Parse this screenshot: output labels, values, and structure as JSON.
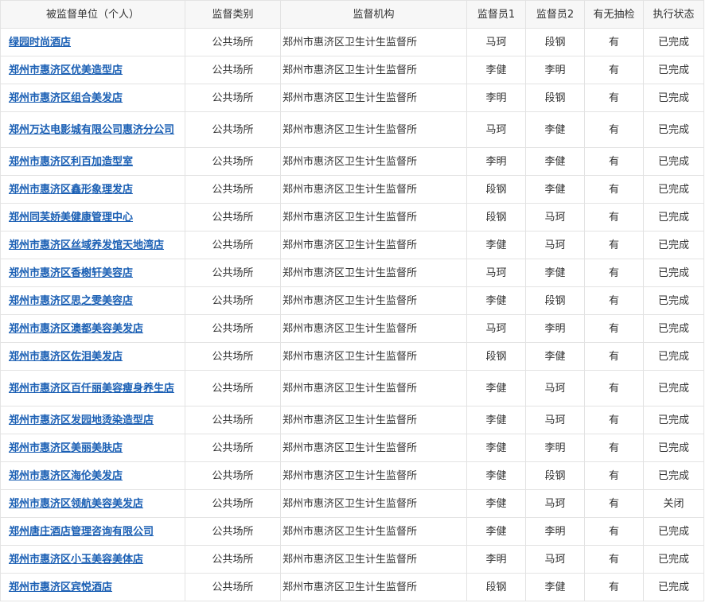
{
  "table": {
    "headers": [
      "被监督单位（个人）",
      "监督类别",
      "监督机构",
      "监督员1",
      "监督员2",
      "有无抽检",
      "执行状态"
    ],
    "rows": [
      {
        "unit": "绿园时尚酒店",
        "category": "公共场所",
        "agency": "郑州市惠济区卫生计生监督所",
        "inspector1": "马珂",
        "inspector2": "段钢",
        "sampling": "有",
        "status": "已完成"
      },
      {
        "unit": "郑州市惠济区优美造型店",
        "category": "公共场所",
        "agency": "郑州市惠济区卫生计生监督所",
        "inspector1": "李健",
        "inspector2": "李明",
        "sampling": "有",
        "status": "已完成"
      },
      {
        "unit": "郑州市惠济区组合美发店",
        "category": "公共场所",
        "agency": "郑州市惠济区卫生计生监督所",
        "inspector1": "李明",
        "inspector2": "段钢",
        "sampling": "有",
        "status": "已完成"
      },
      {
        "unit": "郑州万达电影城有限公司惠济分公司",
        "category": "公共场所",
        "agency": "郑州市惠济区卫生计生监督所",
        "inspector1": "马珂",
        "inspector2": "李健",
        "sampling": "有",
        "status": "已完成"
      },
      {
        "unit": "郑州市惠济区利百加造型室",
        "category": "公共场所",
        "agency": "郑州市惠济区卫生计生监督所",
        "inspector1": "李明",
        "inspector2": "李健",
        "sampling": "有",
        "status": "已完成"
      },
      {
        "unit": "郑州市惠济区鑫形象理发店",
        "category": "公共场所",
        "agency": "郑州市惠济区卫生计生监督所",
        "inspector1": "段钢",
        "inspector2": "李健",
        "sampling": "有",
        "status": "已完成"
      },
      {
        "unit": "郑州同芙娇美健康管理中心",
        "category": "公共场所",
        "agency": "郑州市惠济区卫生计生监督所",
        "inspector1": "段钢",
        "inspector2": "马珂",
        "sampling": "有",
        "status": "已完成"
      },
      {
        "unit": "郑州市惠济区丝域养发馆天地湾店",
        "category": "公共场所",
        "agency": "郑州市惠济区卫生计生监督所",
        "inspector1": "李健",
        "inspector2": "马珂",
        "sampling": "有",
        "status": "已完成"
      },
      {
        "unit": "郑州市惠济区香榭轩美容店",
        "category": "公共场所",
        "agency": "郑州市惠济区卫生计生监督所",
        "inspector1": "马珂",
        "inspector2": "李健",
        "sampling": "有",
        "status": "已完成"
      },
      {
        "unit": "郑州市惠济区思之雯美容店",
        "category": "公共场所",
        "agency": "郑州市惠济区卫生计生监督所",
        "inspector1": "李健",
        "inspector2": "段钢",
        "sampling": "有",
        "status": "已完成"
      },
      {
        "unit": "郑州市惠济区澳都美容美发店",
        "category": "公共场所",
        "agency": "郑州市惠济区卫生计生监督所",
        "inspector1": "马珂",
        "inspector2": "李明",
        "sampling": "有",
        "status": "已完成"
      },
      {
        "unit": "郑州市惠济区佐泪美发店",
        "category": "公共场所",
        "agency": "郑州市惠济区卫生计生监督所",
        "inspector1": "段钢",
        "inspector2": "李健",
        "sampling": "有",
        "status": "已完成"
      },
      {
        "unit": "郑州市惠济区百仟丽美容瘦身养生店",
        "category": "公共场所",
        "agency": "郑州市惠济区卫生计生监督所",
        "inspector1": "李健",
        "inspector2": "马珂",
        "sampling": "有",
        "status": "已完成"
      },
      {
        "unit": "郑州市惠济区发园地烫染造型店",
        "category": "公共场所",
        "agency": "郑州市惠济区卫生计生监督所",
        "inspector1": "李健",
        "inspector2": "马珂",
        "sampling": "有",
        "status": "已完成"
      },
      {
        "unit": "郑州市惠济区美丽美肤店",
        "category": "公共场所",
        "agency": "郑州市惠济区卫生计生监督所",
        "inspector1": "李健",
        "inspector2": "李明",
        "sampling": "有",
        "status": "已完成"
      },
      {
        "unit": "郑州市惠济区海伦美发店",
        "category": "公共场所",
        "agency": "郑州市惠济区卫生计生监督所",
        "inspector1": "李健",
        "inspector2": "段钢",
        "sampling": "有",
        "status": "已完成"
      },
      {
        "unit": "郑州市惠济区领航美容美发店",
        "category": "公共场所",
        "agency": "郑州市惠济区卫生计生监督所",
        "inspector1": "李健",
        "inspector2": "马珂",
        "sampling": "有",
        "status": "关闭"
      },
      {
        "unit": "郑州唐庄酒店管理咨询有限公司",
        "category": "公共场所",
        "agency": "郑州市惠济区卫生计生监督所",
        "inspector1": "李健",
        "inspector2": "李明",
        "sampling": "有",
        "status": "已完成"
      },
      {
        "unit": "郑州市惠济区小玉美容美体店",
        "category": "公共场所",
        "agency": "郑州市惠济区卫生计生监督所",
        "inspector1": "李明",
        "inspector2": "马珂",
        "sampling": "有",
        "status": "已完成"
      },
      {
        "unit": "郑州市惠济区宾悦酒店",
        "category": "公共场所",
        "agency": "郑州市惠济区卫生计生监督所",
        "inspector1": "段钢",
        "inspector2": "李健",
        "sampling": "有",
        "status": "已完成"
      }
    ]
  },
  "colors": {
    "link": "#1a5fb4",
    "border": "#e3e3e3",
    "header_bg": "#f7f7f7",
    "text": "#333333"
  }
}
